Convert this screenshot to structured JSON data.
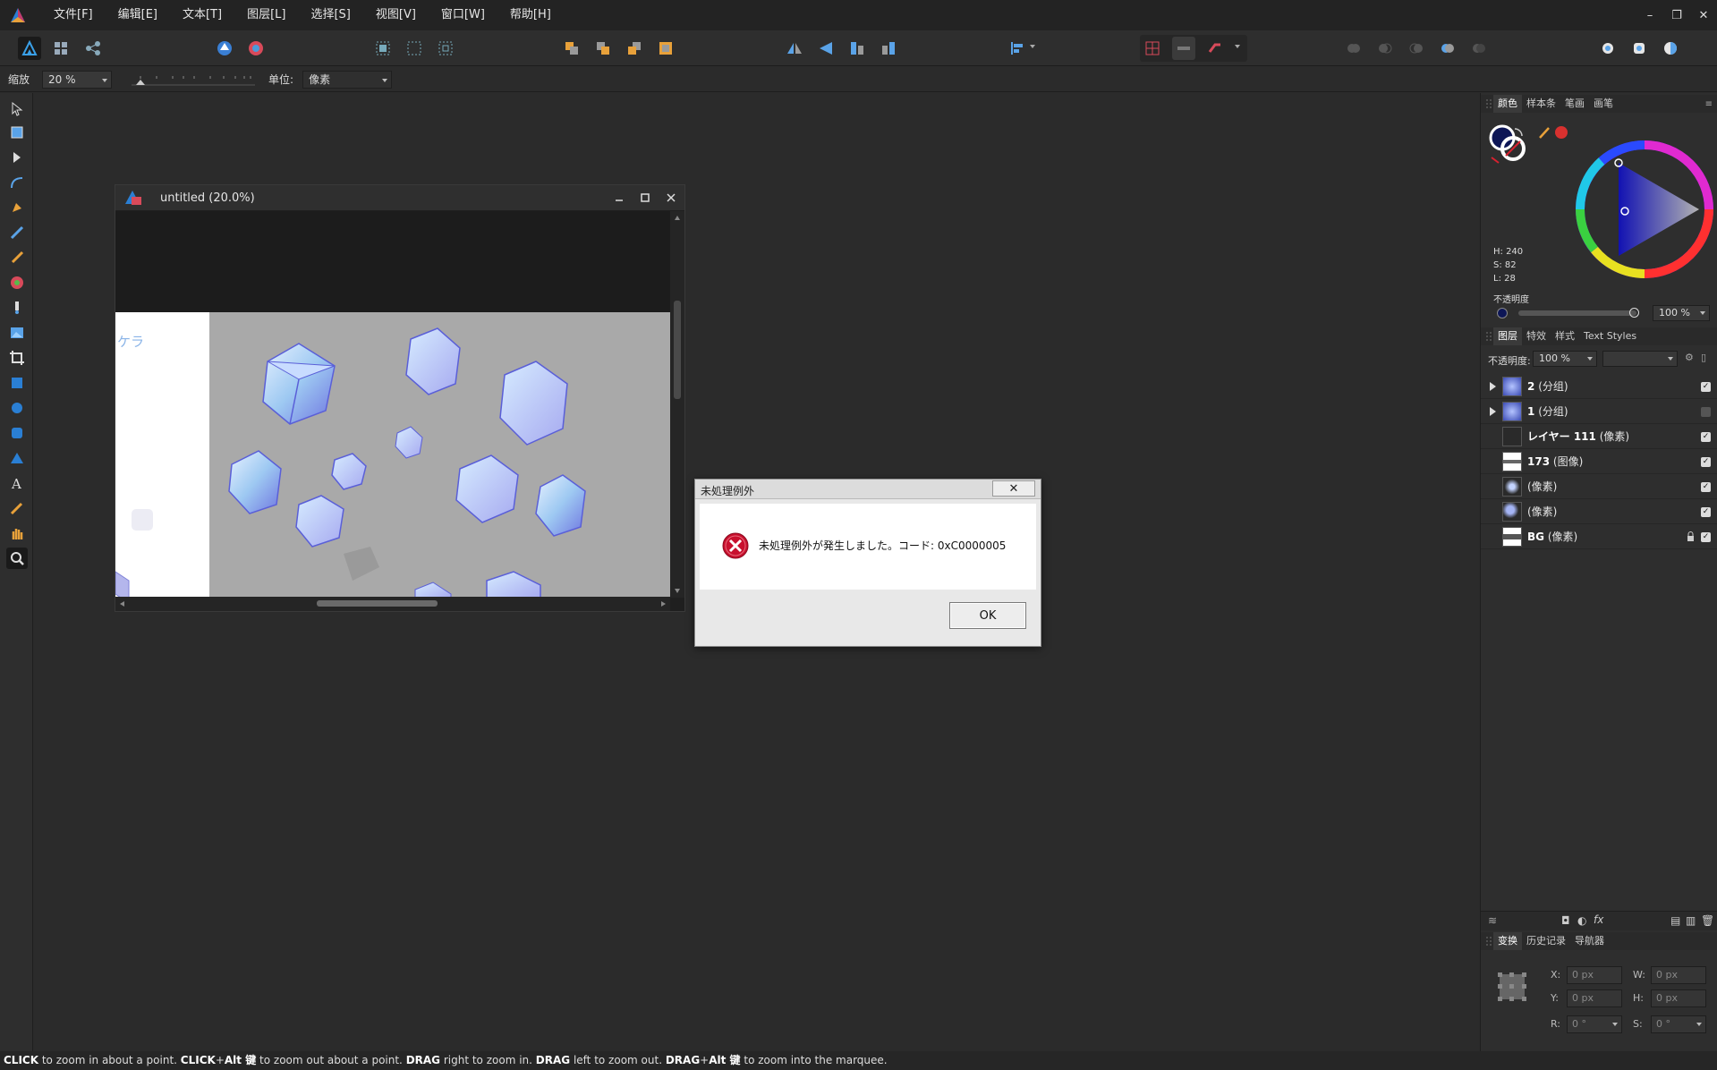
{
  "menu": {
    "items": [
      "文件[F]",
      "编辑[E]",
      "文本[T]",
      "图层[L]",
      "选择[S]",
      "视图[V]",
      "窗口[W]",
      "帮助[H]"
    ],
    "minimize_glyph": "–",
    "restore_glyph": "❐",
    "close_glyph": "✕"
  },
  "context": {
    "zoom_label": "缩放",
    "zoom_value": "20 %",
    "unit_label": "单位:",
    "unit_value": "像素"
  },
  "document": {
    "title": "untitled (20.0%)",
    "canvas_text": "ケラ"
  },
  "dialog": {
    "title": "未処理例外",
    "message": "未処理例外が発生しました。コード: 0xC0000005",
    "ok_label": "OK",
    "close_glyph": "✕"
  },
  "color_panel": {
    "tabs": [
      "颜色",
      "样本条",
      "笔画",
      "画笔"
    ],
    "h": "H: 240",
    "s": "S: 82",
    "l": "L: 28",
    "opacity_label": "不透明度",
    "opacity_value": "100 %",
    "current_color": "#0d1656"
  },
  "layers_panel": {
    "tabs": [
      "图层",
      "特效",
      "样式",
      "Text Styles"
    ],
    "opacity_label": "不透明度:",
    "opacity_value": "100 %",
    "layers": [
      {
        "name": "2",
        "type": "(分组)",
        "has_children": true,
        "visible": true,
        "locked": false
      },
      {
        "name": "1",
        "type": "(分组)",
        "has_children": true,
        "visible": false,
        "locked": false
      },
      {
        "name": "レイヤー 111",
        "type": "(像素)",
        "has_children": false,
        "visible": true,
        "locked": false
      },
      {
        "name": "173",
        "type": "(图像)",
        "has_children": false,
        "visible": true,
        "locked": false
      },
      {
        "name": "",
        "type": "(像素)",
        "has_children": false,
        "visible": true,
        "locked": false
      },
      {
        "name": "",
        "type": "(像素)",
        "has_children": false,
        "visible": true,
        "locked": false
      },
      {
        "name": "BG",
        "type": "(像素)",
        "has_children": false,
        "visible": true,
        "locked": true
      }
    ],
    "fx_label": "fx"
  },
  "transform_panel": {
    "tabs": [
      "变换",
      "历史记录",
      "导航器"
    ],
    "x_label": "X:",
    "x_value": "0 px",
    "y_label": "Y:",
    "y_value": "0 px",
    "w_label": "W:",
    "w_value": "0 px",
    "h_label": "H:",
    "h_value": "0 px",
    "r_label": "R:",
    "r_value": "0 °",
    "s_label": "S:",
    "s_value": "0 °"
  },
  "status": {
    "parts": [
      {
        "text": "CLICK",
        "bold": true
      },
      {
        "text": " to zoom in about a point. ",
        "bold": false
      },
      {
        "text": "CLICK",
        "bold": true
      },
      {
        "text": "+",
        "bold": false
      },
      {
        "text": "Alt 键",
        "bold": true
      },
      {
        "text": " to zoom out about a point. ",
        "bold": false
      },
      {
        "text": "DRAG",
        "bold": true
      },
      {
        "text": " right to zoom in. ",
        "bold": false
      },
      {
        "text": "DRAG",
        "bold": true
      },
      {
        "text": " left to zoom out. ",
        "bold": false
      },
      {
        "text": "DRAG",
        "bold": true
      },
      {
        "text": "+",
        "bold": false
      },
      {
        "text": "Alt 键",
        "bold": true
      },
      {
        "text": " to zoom into the marquee.",
        "bold": false
      }
    ]
  },
  "icons": {
    "app": "affinity-photo-logo-icon",
    "error": "error-x-icon"
  }
}
